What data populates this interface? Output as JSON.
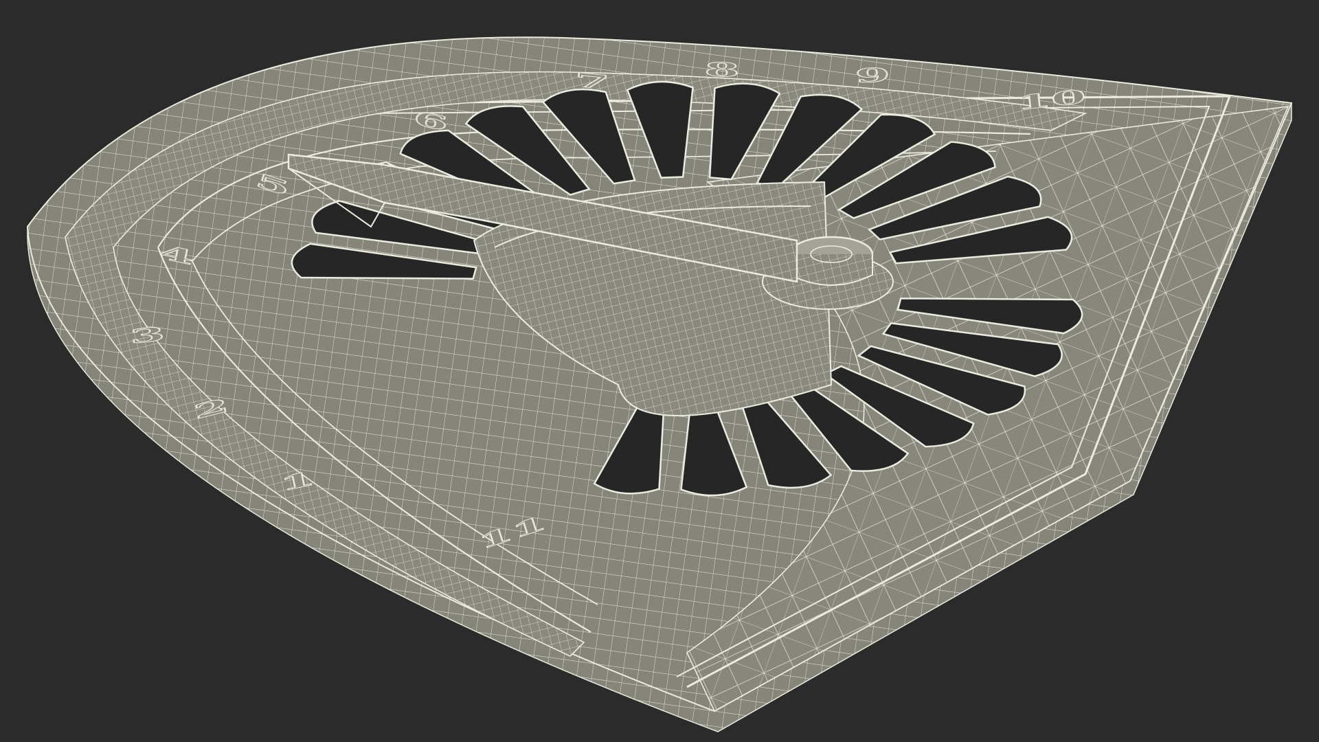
{
  "scene": {
    "background_color": "#2b2b2b",
    "mesh_fill": "#86857a",
    "mesh_fill_dark": "#6d6c62",
    "wire_color": "#ecebe0",
    "opening_color": "#262626"
  },
  "numerals": [
    {
      "id": "numeral-1",
      "text": "1"
    },
    {
      "id": "numeral-2",
      "text": "2"
    },
    {
      "id": "numeral-3",
      "text": "3"
    },
    {
      "id": "numeral-4",
      "text": "4"
    },
    {
      "id": "numeral-5",
      "text": "5"
    },
    {
      "id": "numeral-6",
      "text": "6"
    },
    {
      "id": "numeral-7",
      "text": "7"
    },
    {
      "id": "numeral-8",
      "text": "8"
    },
    {
      "id": "numeral-9",
      "text": "9"
    },
    {
      "id": "numeral-10",
      "text": "10"
    },
    {
      "id": "numeral-11",
      "text": "11"
    }
  ]
}
